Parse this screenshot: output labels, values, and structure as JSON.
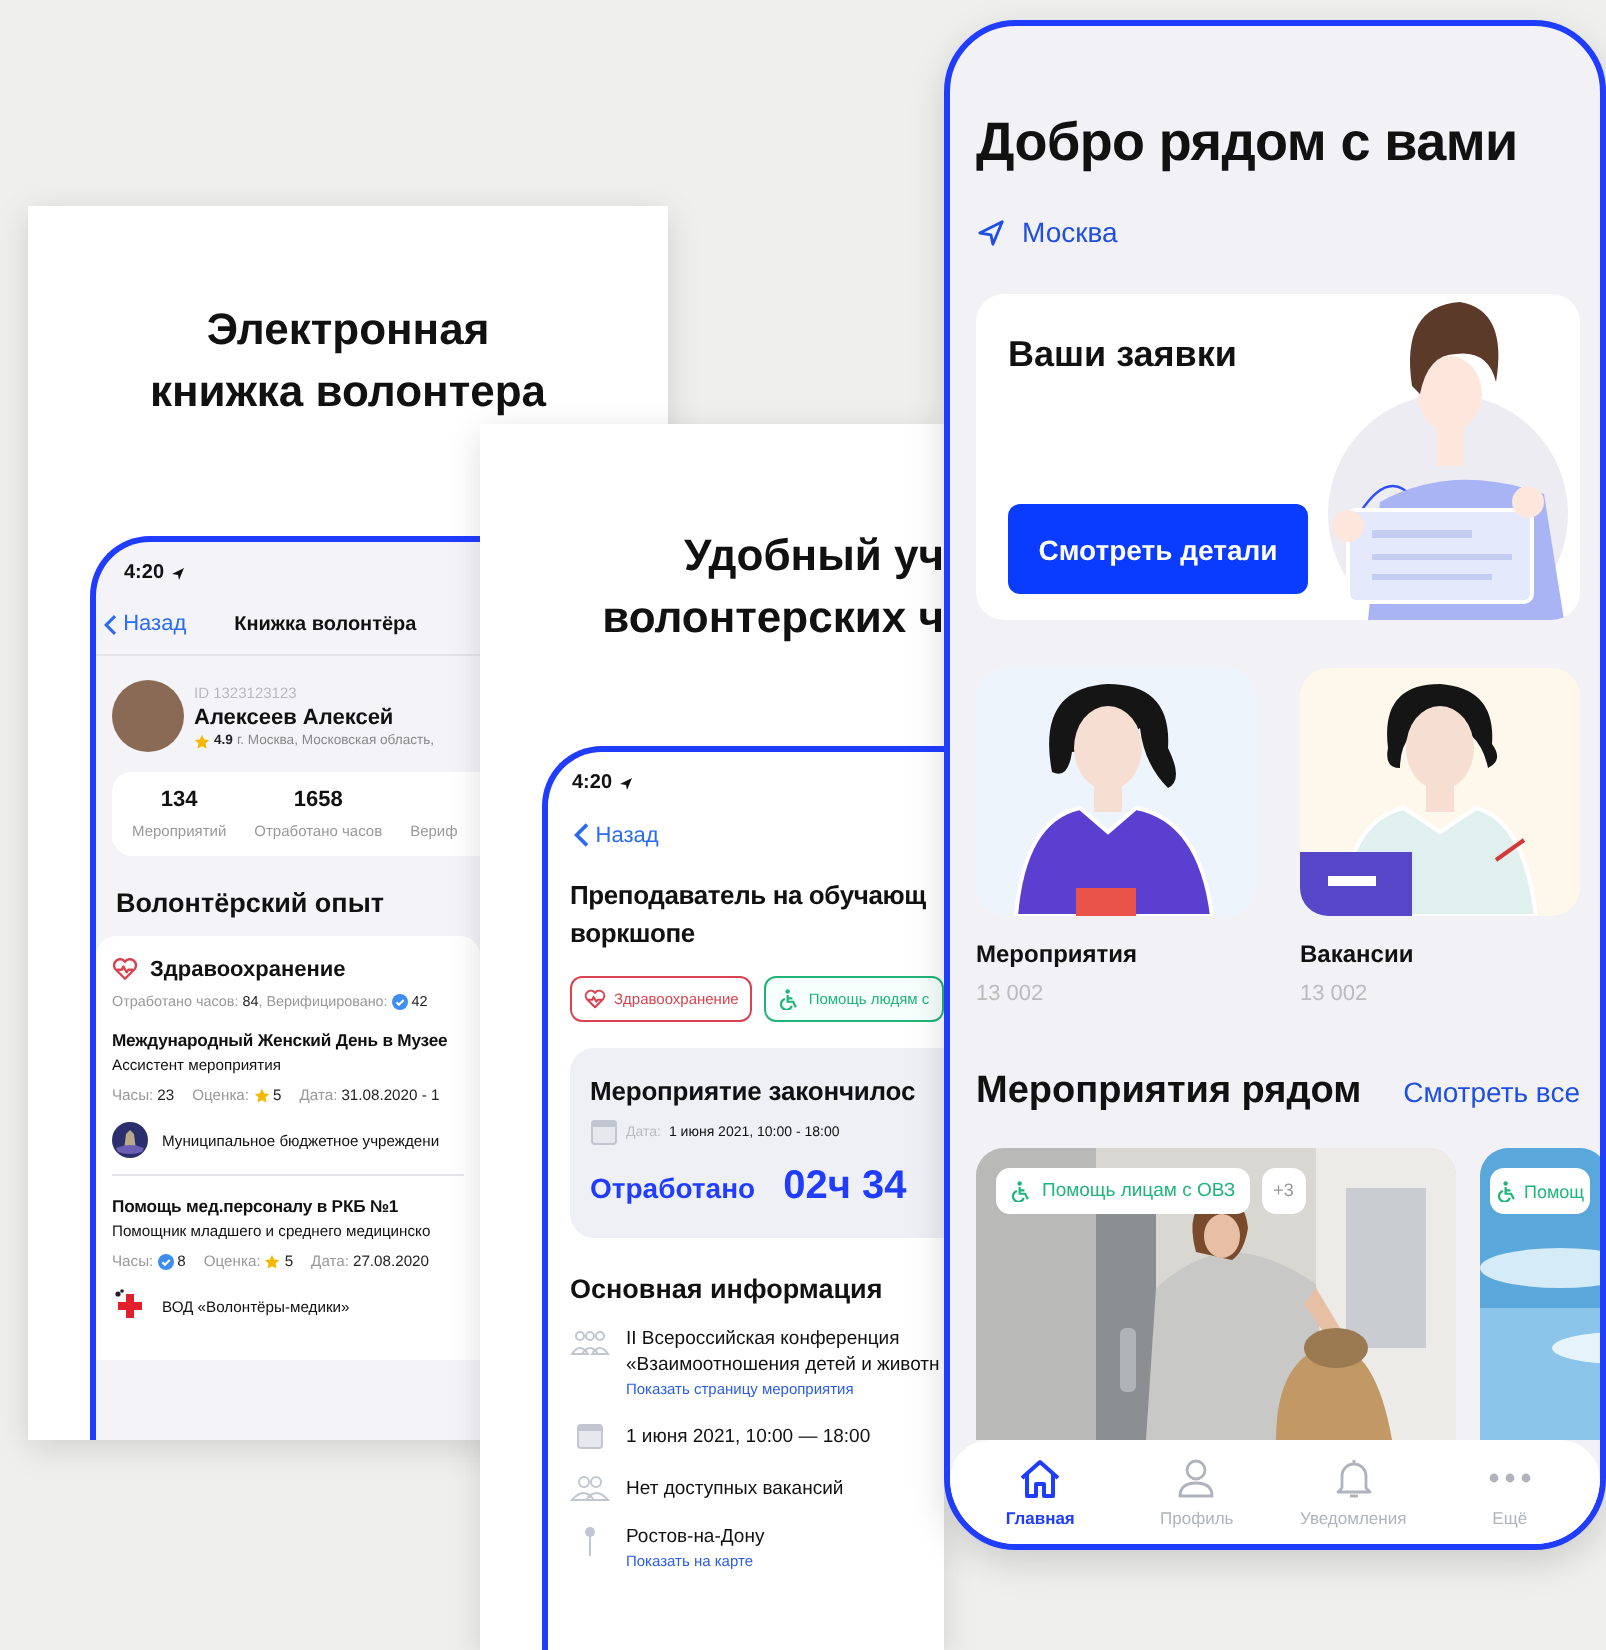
{
  "book_card": {
    "headline": [
      "Электронная",
      "книжка волонтера"
    ],
    "phone": {
      "time": "4:20",
      "back": "Назад",
      "title": "Книжка волонтёра",
      "profile": {
        "id": "ID 1323123123",
        "name": "Алексеев Алексей",
        "rating": "4.9",
        "location": "г. Москва, Московская область,"
      },
      "stats": [
        {
          "value": "134",
          "label": "Мероприятий"
        },
        {
          "value": "1658",
          "label": "Отработано часов"
        },
        {
          "label": "Вериф"
        }
      ],
      "section": "Волонтёрский опыт",
      "category": {
        "name": "Здравоохранение",
        "summary": "Отработано часов: **84**, Верифицировано:",
        "verified": "42"
      },
      "entries": [
        {
          "title": "Международный Женский День в Музее",
          "role": "Ассистент мероприятия",
          "hours_label": "Часы:",
          "hours": "23",
          "hours_verified": false,
          "rating_label": "Оценка:",
          "rating": "5",
          "date_label": "Дата:",
          "date": "31.08.2020 - 1",
          "org": "Муниципальное бюджетное учреждени"
        },
        {
          "title": "Помощь мед.персоналу в РКБ №1",
          "role": "Помощник младшего и среднего медицинско",
          "hours_label": "Часы:",
          "hours": "8",
          "hours_verified": true,
          "rating_label": "Оценка:",
          "rating": "5",
          "date_label": "Дата:",
          "date": "27.08.2020",
          "org": "ВОД «Волонтёры-медики»"
        }
      ]
    }
  },
  "hours_card": {
    "headline": [
      "Удобный уч",
      "волонтерских ч"
    ],
    "phone": {
      "time": "4:20",
      "back": "Назад",
      "title_lines": [
        "Преподаватель на обучающ",
        "воркшопе"
      ],
      "tags": [
        {
          "label": "Здравоохранение",
          "kind": "health",
          "color": "#d9434f"
        },
        {
          "label": "Помощь людям с",
          "kind": "accessibility",
          "color": "#1fb57a"
        }
      ],
      "status": {
        "title": "Мероприятие закончилос",
        "date_label": "Дата:",
        "date": "1 июня 2021, 10:00 - 18:00",
        "worked_label": "Отработано",
        "worked": "02ч 34"
      },
      "info_title": "Основная информация",
      "info": [
        {
          "kind": "event",
          "lines": [
            "II Всероссийская конференция",
            "«Взаимоотношения детей и животн"
          ],
          "link": "Показать страницу мероприятия"
        },
        {
          "kind": "date",
          "lines": [
            "1 июня 2021, 10:00 — 18:00"
          ]
        },
        {
          "kind": "vacancies",
          "lines": [
            "Нет доступных вакансий"
          ]
        },
        {
          "kind": "place",
          "lines": [
            "Ростов-на-Дону"
          ],
          "link": "Показать на карте"
        }
      ]
    }
  },
  "home_screen": {
    "title": "Добро рядом с вами",
    "city": "Москва",
    "requests": {
      "title": "Ваши заявки",
      "button": "Смотреть детали"
    },
    "tiles": [
      {
        "label": "Мероприятия",
        "count": "13 002"
      },
      {
        "label": "Вакансии",
        "count": "13 002"
      }
    ],
    "nearby": {
      "title": "Мероприятия рядом",
      "link": "Смотреть все",
      "events": [
        {
          "tag": "Помощь лицам с ОВЗ",
          "extra": "+3"
        },
        {
          "tag": "Помощ"
        }
      ]
    },
    "tabs": [
      {
        "label": "Главная",
        "kind": "home",
        "selected": true
      },
      {
        "label": "Профиль",
        "kind": "profile",
        "selected": false
      },
      {
        "label": "Уведомления",
        "kind": "notifications",
        "selected": false
      },
      {
        "label": "Ещё",
        "kind": "more",
        "selected": false
      }
    ]
  }
}
